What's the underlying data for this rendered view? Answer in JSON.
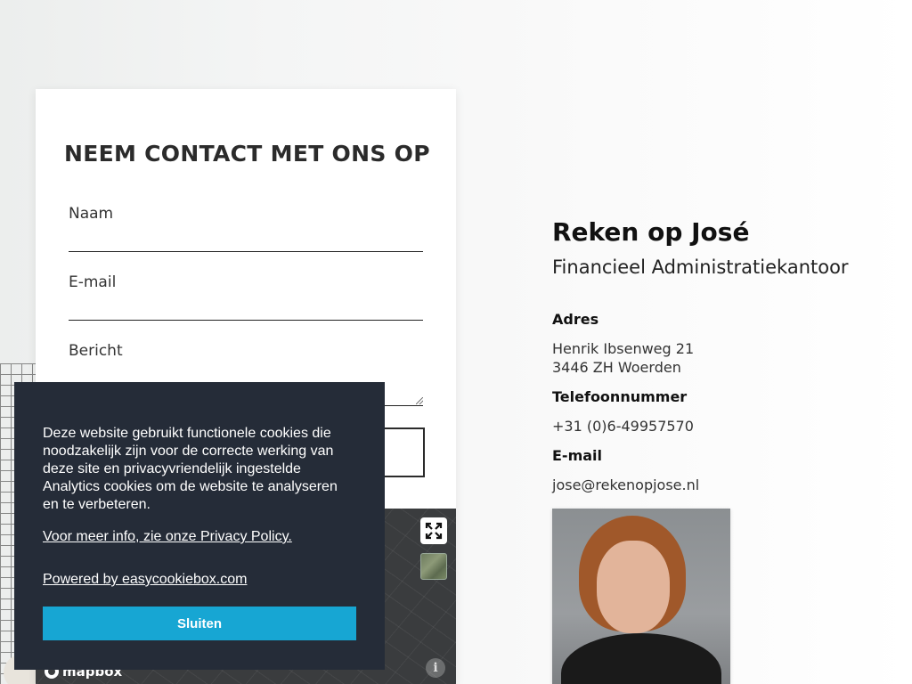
{
  "contact_form": {
    "title": "NEEM CONTACT MET ONS OP",
    "fields": [
      {
        "label": "Naam"
      },
      {
        "label": "E-mail"
      },
      {
        "label": "Bericht"
      }
    ]
  },
  "map": {
    "attribution_logo": "mapbox",
    "info_glyph": "i",
    "fullscreen_icon": "expand-icon",
    "layer_icon": "satellite-thumbnail"
  },
  "cookie_banner": {
    "text": "Deze website gebruikt functionele cookies die noodzakelijk zijn voor de correcte werking van deze site en privacyvriendelijk ingestelde Analytics cookies om de website te analyseren en te verbeteren.",
    "privacy_link": "Voor meer info, zie onze Privacy Policy.",
    "powered_link": "Powered by easycookiebox.com",
    "close_label": "Sluiten",
    "button_color": "#17a6d3",
    "background_color": "#252c38"
  },
  "company": {
    "name": "Reken op José",
    "subtitle": "Financieel Administratiekantoor",
    "address_heading": "Adres",
    "address_line1": "Henrik Ibsenweg 21",
    "address_line2": "3446 ZH Woerden",
    "phone_heading": "Telefoonnummer",
    "phone": "+31 (0)6-49957570",
    "email_heading": "E-mail",
    "email": "jose@rekenopjose.nl"
  }
}
